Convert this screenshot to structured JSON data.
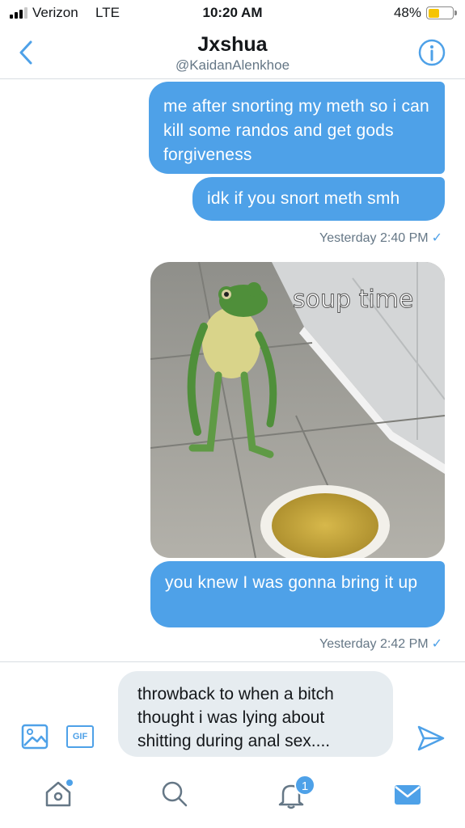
{
  "status_bar": {
    "carrier": "Verizon",
    "network": "LTE",
    "time": "10:20 AM",
    "battery_percent": "48%",
    "battery_level": 0.48
  },
  "header": {
    "name": "Jxshua",
    "handle": "@KaidanAlenkhoe",
    "back_icon": "chevron-left-icon",
    "info_icon": "info-icon"
  },
  "messages": [
    {
      "text": "me after snorting my meth so i can kill some randos and get gods forgiveness"
    },
    {
      "text": "idk if you snort meth smh"
    },
    {
      "timestamp": "Yesterday 2:40 PM",
      "check": "✓"
    },
    {
      "image_caption": "soup time"
    },
    {
      "text": "you knew I was gonna bring it up"
    },
    {
      "timestamp": "Yesterday 2:42 PM",
      "check": "✓"
    }
  ],
  "compose": {
    "draft_text": "throwback to when a bitch thought i was lying about shitting during anal sex....",
    "gif_label": "GIF",
    "photo_icon": "image-icon",
    "send_icon": "send-icon"
  },
  "tabbar": {
    "home_icon": "home-icon",
    "search_icon": "search-icon",
    "notifications_icon": "bell-icon",
    "notifications_badge": "1",
    "messages_icon": "mail-icon"
  },
  "colors": {
    "accent": "#4ea1e8",
    "bubble_text": "#ffffff",
    "muted": "#657786",
    "compose_bg": "#e6ecf0"
  }
}
